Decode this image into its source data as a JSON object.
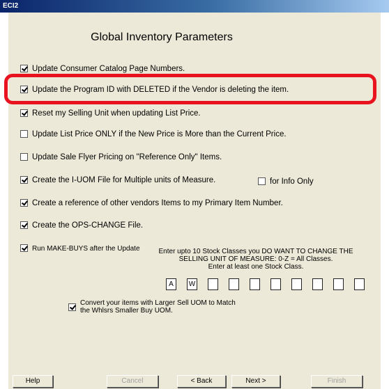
{
  "window": {
    "title": "ECI2"
  },
  "heading": "Global Inventory Parameters",
  "options": [
    {
      "label": "Update Consumer Catalog Page Numbers.",
      "checked": true
    },
    {
      "label": "Update the Program ID with DELETED if the Vendor is deleting the item.",
      "checked": true
    },
    {
      "label": "Reset my Selling Unit when updating List Price.",
      "checked": true
    },
    {
      "label": "Update List Price ONLY if the New Price is More than the Current Price.",
      "checked": false
    },
    {
      "label": "Update Sale Flyer Pricing on \"Reference Only\" Items.",
      "checked": false
    },
    {
      "label": "Create the I-UOM File for Multiple units of Measure.",
      "checked": true
    },
    {
      "label": "Create a reference of other vendors Items to my Primary Item Number.",
      "checked": true
    },
    {
      "label": "Create the OPS-CHANGE File.",
      "checked": true
    }
  ],
  "info_only": {
    "label": "for Info Only",
    "checked": false
  },
  "make_buys": {
    "label": "Run MAKE-BUYS after the Update",
    "checked": true
  },
  "stock_classes": {
    "instructions": [
      "Enter upto 10 Stock Classes you DO WANT TO CHANGE THE",
      "SELLING UNIT OF MEASURE: 0-Z = All Classes.",
      "Enter at least one Stock Class."
    ],
    "values": [
      "A",
      "W",
      "",
      "",
      "",
      "",
      "",
      "",
      "",
      ""
    ]
  },
  "convert": {
    "lines": [
      "Convert your items with Larger Sell UOM to Match",
      "the Whlsrs Smaller Buy UOM."
    ],
    "checked": true
  },
  "buttons": {
    "help": "Help",
    "cancel": "Cancel",
    "back": "< Back",
    "next": "Next >",
    "finish": "Finish"
  },
  "colors": {
    "highlight": "#e8131e",
    "dialog_bg": "#ece9d8"
  }
}
